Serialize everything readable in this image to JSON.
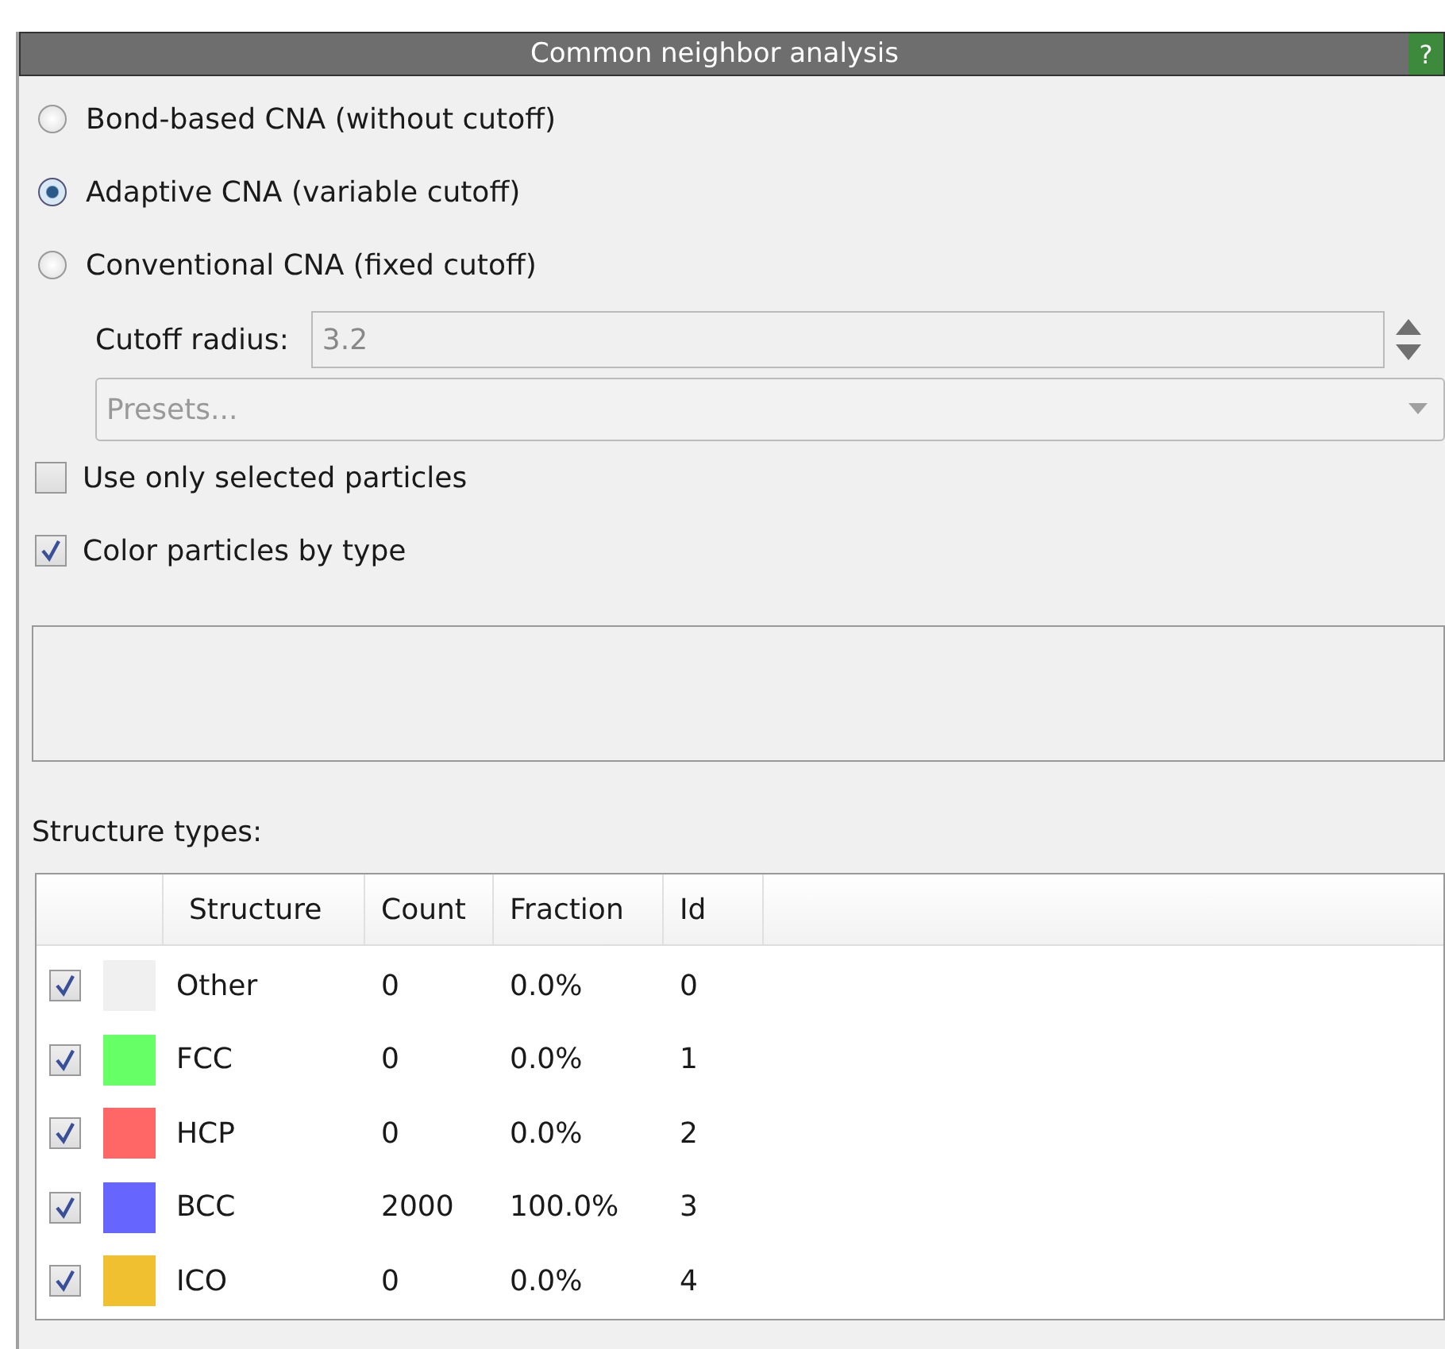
{
  "panel": {
    "title": "Common neighbor analysis",
    "help_button": "?"
  },
  "modes": [
    {
      "label": "Bond-based CNA (without cutoff)",
      "selected": false
    },
    {
      "label": "Adaptive CNA (variable cutoff)",
      "selected": true
    },
    {
      "label": "Conventional CNA (fixed cutoff)",
      "selected": false
    }
  ],
  "cutoff": {
    "label": "Cutoff radius:",
    "value": "3.2",
    "disabled": true
  },
  "presets": {
    "placeholder": "Presets...",
    "disabled": true
  },
  "options": [
    {
      "label": "Use only selected particles",
      "checked": false
    },
    {
      "label": "Color particles by type",
      "checked": true
    }
  ],
  "structure_types": {
    "label": "Structure types:",
    "columns": [
      "Structure",
      "Count",
      "Fraction",
      "Id"
    ],
    "rows": [
      {
        "checked": true,
        "color": "#f0f0f0",
        "structure": "Other",
        "count": "0",
        "fraction": "0.0%",
        "id": "0"
      },
      {
        "checked": true,
        "color": "#66ff66",
        "structure": "FCC",
        "count": "0",
        "fraction": "0.0%",
        "id": "1"
      },
      {
        "checked": true,
        "color": "#ff6666",
        "structure": "HCP",
        "count": "0",
        "fraction": "0.0%",
        "id": "2"
      },
      {
        "checked": true,
        "color": "#6666ff",
        "structure": "BCC",
        "count": "2000",
        "fraction": "100.0%",
        "id": "3"
      },
      {
        "checked": true,
        "color": "#f0c030",
        "structure": "ICO",
        "count": "0",
        "fraction": "0.0%",
        "id": "4"
      }
    ]
  }
}
